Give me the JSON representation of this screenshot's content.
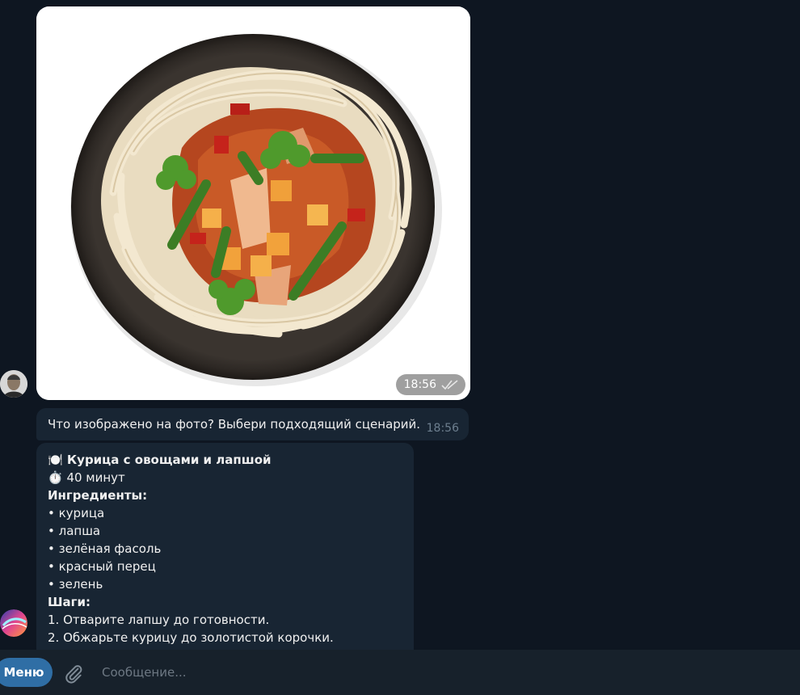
{
  "photo_message": {
    "time": "18:56"
  },
  "question_message": {
    "text": "Что изображено на фото? Выбери подходящий сценарий.",
    "time": "18:56"
  },
  "reply_message": {
    "lines": [
      {
        "text": "🍽️ Курица с овощами и лапшой",
        "bold": true
      },
      {
        "text": "⏱️ 40 минут",
        "bold": false
      },
      {
        "text": "Ингредиенты:",
        "bold": true
      },
      {
        "text": "• курица",
        "bold": false
      },
      {
        "text": "• лапша",
        "bold": false
      },
      {
        "text": "• зелёная фасоль",
        "bold": false
      },
      {
        "text": "• красный перец",
        "bold": false
      },
      {
        "text": "• зелень",
        "bold": false
      },
      {
        "text": "Шаги:",
        "bold": true
      },
      {
        "text": "1. Отварите лапшу до готовности.",
        "bold": false
      },
      {
        "text": "2. Обжарьте курицу до золотистой корочки.",
        "bold": false
      }
    ]
  },
  "composer": {
    "menu_label": "Меню",
    "placeholder": "Сообщение..."
  },
  "colors": {
    "background": "#0e1621",
    "bubble": "#182533",
    "composer": "#17212b",
    "accent": "#2f6ea5"
  }
}
